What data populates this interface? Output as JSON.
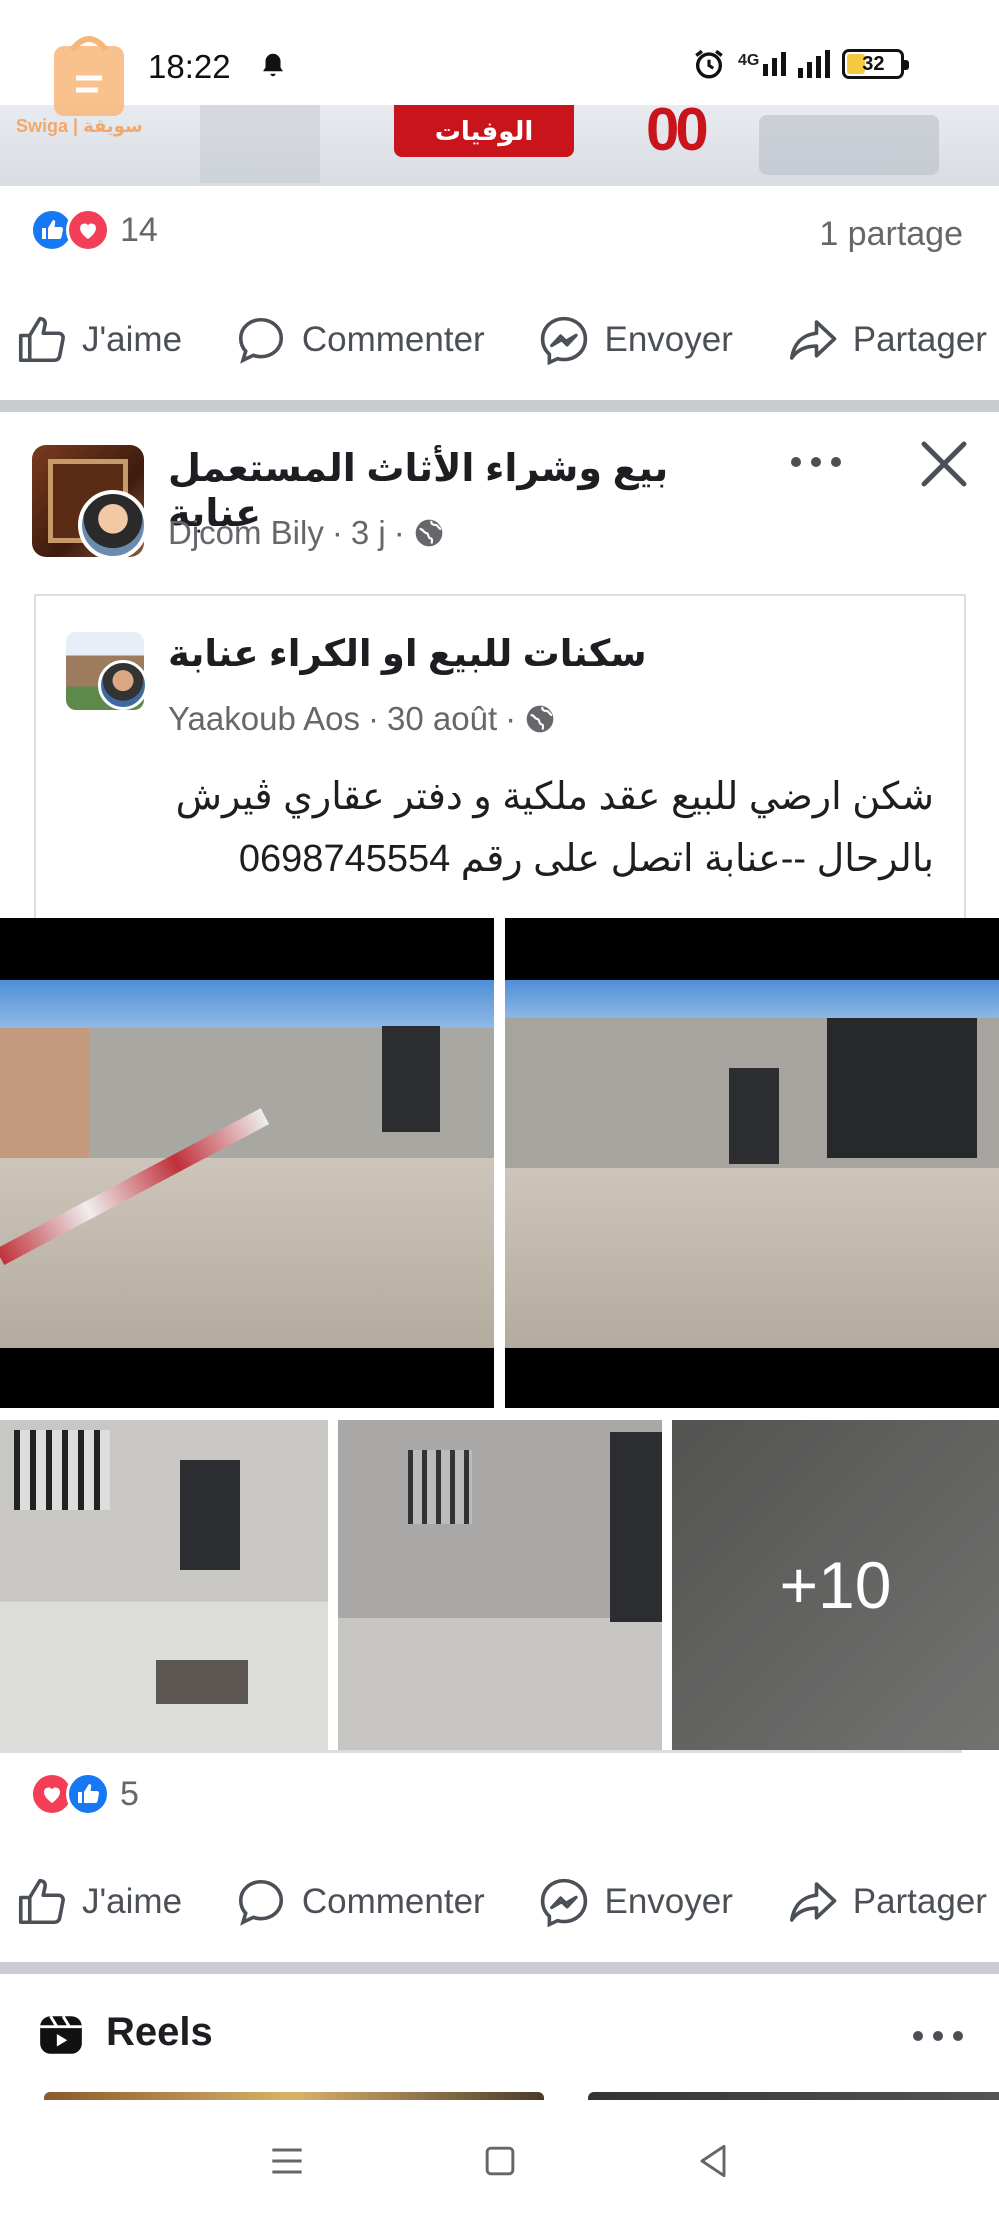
{
  "status_bar": {
    "time": "18:22",
    "network": "4G",
    "battery": "32",
    "watermark": "Swiga | سويقة"
  },
  "top_strip": {
    "label": "الوفيات",
    "number": "00"
  },
  "post1": {
    "reaction_count": "14",
    "shares": "1 partage"
  },
  "actions": {
    "like": "J'aime",
    "comment": "Commenter",
    "send": "Envoyer",
    "share": "Partager"
  },
  "post2": {
    "group_name": "بيع وشراء الأثاث المستعمل عنابة",
    "author": "Djcom Bily",
    "time": "3 j",
    "shared": {
      "page_name": "سكنات للبيع او الكراء عنابة",
      "author": "Yaakoub Aos",
      "date": "30 août",
      "text_line1": "شكن ارضي للبيع عقد ملكية و دفتر عقاري ڤيرش",
      "text_line2": "بالرحال --عنابة اتصل على رقم 0698745554"
    },
    "more_photos": "+10",
    "reaction_count": "5"
  },
  "reels": {
    "title": "Reels"
  },
  "colors": {
    "like_blue": "#1877f2",
    "love_red": "#f33e58",
    "secondary_text": "#65676b"
  }
}
